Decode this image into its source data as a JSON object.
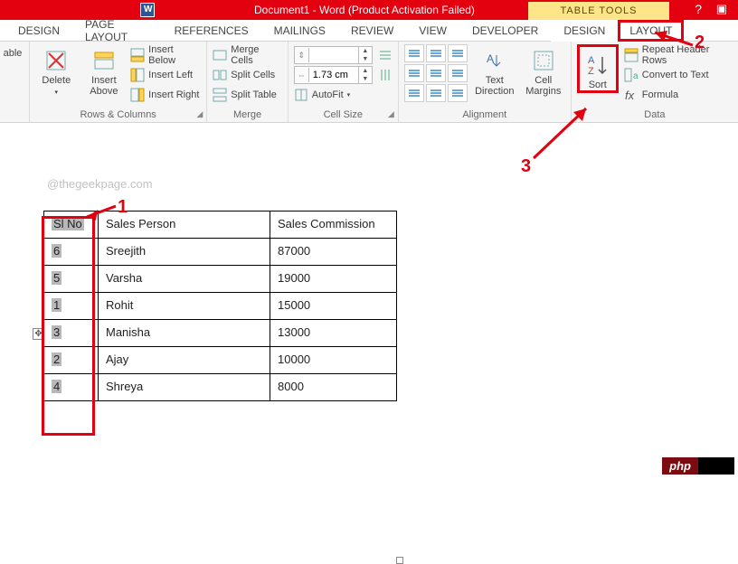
{
  "titlebar": {
    "title": "Document1 -  Word (Product Activation Failed)",
    "table_tools": "TABLE TOOLS"
  },
  "tabs": {
    "design": "DESIGN",
    "page_layout": "PAGE LAYOUT",
    "references": "REFERENCES",
    "mailings": "MAILINGS",
    "review": "REVIEW",
    "view": "VIEW",
    "developer": "DEVELOPER",
    "tt_design": "DESIGN",
    "tt_layout": "LAYOUT"
  },
  "ribbon": {
    "table_partial": "able",
    "delete": "Delete",
    "insert_above": "Insert\nAbove",
    "insert_below": "Insert Below",
    "insert_left": "Insert Left",
    "insert_right": "Insert Right",
    "rows_cols": "Rows & Columns",
    "merge_cells": "Merge Cells",
    "split_cells": "Split Cells",
    "split_table": "Split Table",
    "merge": "Merge",
    "height_val": "",
    "width_val": "1.73 cm",
    "autofit": "AutoFit",
    "cell_size": "Cell Size",
    "text_direction": "Text\nDirection",
    "cell_margins": "Cell\nMargins",
    "alignment": "Alignment",
    "sort": "Sort",
    "repeat_header": "Repeat Header Rows",
    "convert_text": "Convert to Text",
    "formula": "Formula",
    "data": "Data"
  },
  "doc": {
    "watermark": "@thegeekpage.com",
    "headers": {
      "c1": "Sl No",
      "c2": "Sales Person",
      "c3": "Sales Commission"
    },
    "rows": [
      {
        "no": "6",
        "person": "Sreejith",
        "comm": "87000"
      },
      {
        "no": "5",
        "person": "Varsha",
        "comm": "19000"
      },
      {
        "no": "1",
        "person": "Rohit",
        "comm": "15000"
      },
      {
        "no": "3",
        "person": "Manisha",
        "comm": "13000"
      },
      {
        "no": "2",
        "person": "Ajay",
        "comm": "10000"
      },
      {
        "no": "4",
        "person": "Shreya",
        "comm": "8000"
      }
    ]
  },
  "annotations": {
    "n1": "1",
    "n2": "2",
    "n3": "3"
  },
  "badge": {
    "php": "php"
  }
}
